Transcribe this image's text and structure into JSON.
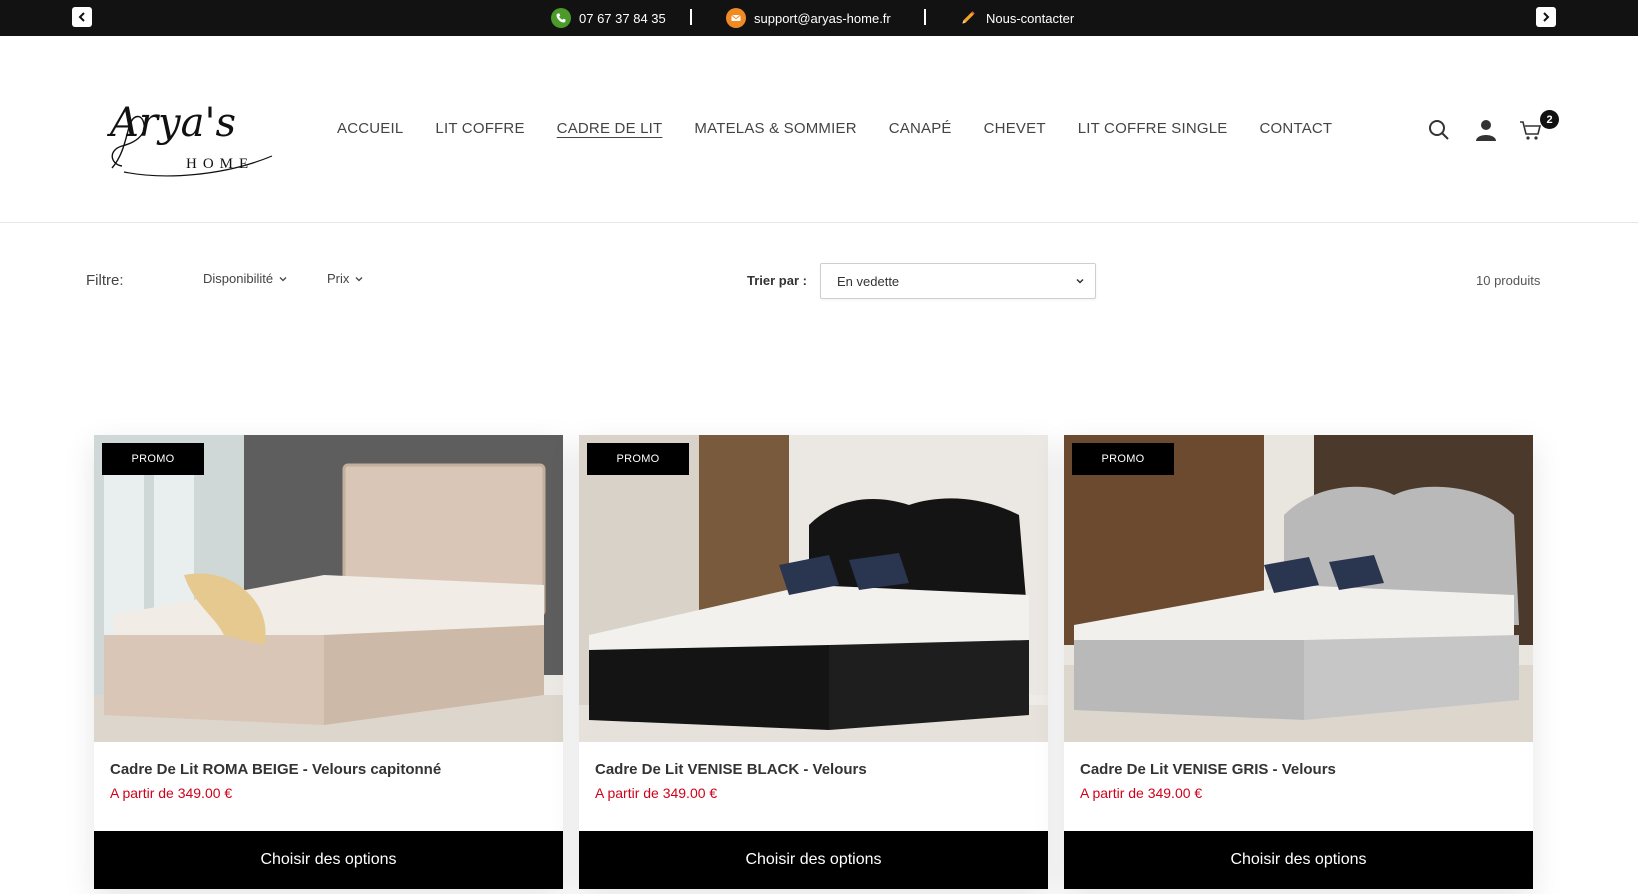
{
  "topbar": {
    "phone": "07 67 37 84 35",
    "email": "support@aryas-home.fr",
    "contact": "Nous-contacter",
    "separator": "|"
  },
  "header": {
    "logo_text": "Arya's",
    "logo_subtext": "HOME",
    "nav": [
      {
        "label": "ACCUEIL",
        "active": false
      },
      {
        "label": "LIT COFFRE",
        "active": false
      },
      {
        "label": "CADRE DE LIT",
        "active": true
      },
      {
        "label": "MATELAS & SOMMIER",
        "active": false
      },
      {
        "label": "CANAPÉ",
        "active": false
      },
      {
        "label": "CHEVET",
        "active": false
      },
      {
        "label": "LIT COFFRE SINGLE",
        "active": false
      },
      {
        "label": "CONTACT",
        "active": false
      }
    ],
    "cart_count": "2",
    "icons": [
      "search-icon",
      "account-icon",
      "cart-icon"
    ]
  },
  "filters": {
    "label": "Filtre:",
    "availability": "Disponibilité",
    "price": "Prix",
    "sort_label": "Trier par :",
    "sort_value": "En vedette",
    "count": "10 produits"
  },
  "products": [
    {
      "badge": "PROMO",
      "title": "Cadre De Lit ROMA BEIGE - Velours capitonné",
      "price": "A partir de 349.00 €",
      "button": "Choisir des options",
      "color": "#d9c6b6"
    },
    {
      "badge": "PROMO",
      "title": "Cadre De Lit VENISE BLACK - Velours",
      "price": "A partir de 349.00 €",
      "button": "Choisir des options",
      "color": "#141414"
    },
    {
      "badge": "PROMO",
      "title": "Cadre De Lit VENISE GRIS - Velours",
      "price": "A partir de 349.00 €",
      "button": "Choisir des options",
      "color": "#b9b9b9"
    }
  ],
  "colors": {
    "topbar": "#121212",
    "price": "#d0021b",
    "button": "#000000"
  }
}
